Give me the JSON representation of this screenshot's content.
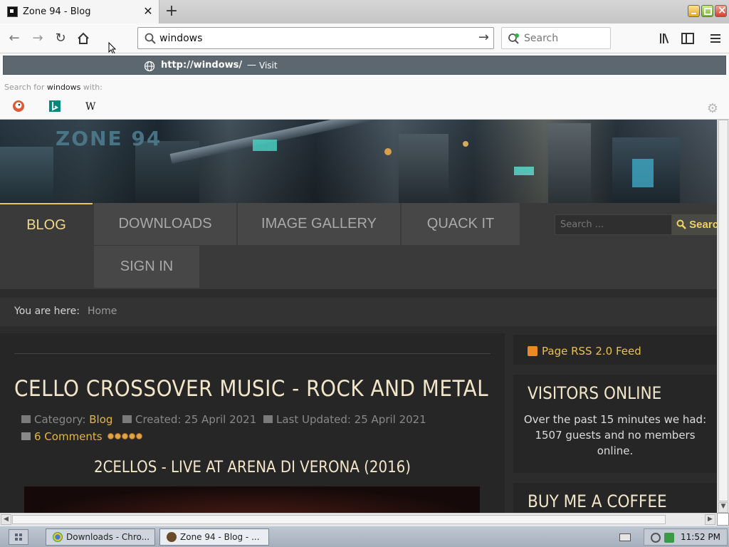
{
  "browser": {
    "tab": {
      "title": "Zone 94 - Blog"
    },
    "url_input": {
      "value": "windows "
    },
    "search_placeholder": "Search",
    "dropdown": {
      "url": "http://windows/",
      "dash": "—",
      "visit": "Visit",
      "search_for_prefix": "Search for",
      "search_for_term": "windows",
      "search_for_suffix": "with:"
    },
    "engines": [
      "duckduckgo-icon",
      "bing-icon",
      "wikipedia-icon"
    ]
  },
  "site": {
    "logo_text": "ZONE 94",
    "nav": [
      {
        "label": "BLOG",
        "active": true
      },
      {
        "label": "DOWNLOADS"
      },
      {
        "label": "IMAGE GALLERY"
      },
      {
        "label": "QUACK IT"
      },
      {
        "label": "SIGN IN"
      }
    ],
    "search_placeholder": "Search ...",
    "search_button": "Search",
    "breadcrumb": {
      "prefix": "You are here:",
      "home": "Home"
    },
    "article": {
      "title": "CELLO CROSSOVER MUSIC - ROCK AND METAL",
      "category_label": "Category:",
      "category": "Blog",
      "created": "Created: 25 April 2021",
      "updated": "Last Updated: 25 April 2021",
      "comments": "6 Comments",
      "rating_stars": 5,
      "subtitle": "2CELLOS - LIVE AT ARENA DI VERONA (2016)"
    },
    "sidebar": {
      "rss": "Page RSS 2.0 Feed",
      "visitors_title": "VISITORS ONLINE",
      "visitors_text": "Over the past 15 minutes we had: 1507 guests and no members online.",
      "coffee_title": "BUY ME A COFFEE"
    }
  },
  "taskbar": {
    "items": [
      "Downloads - Chro...",
      "Zone 94 - Blog - ..."
    ],
    "clock": "11:52 PM"
  },
  "colors": {
    "accent": "#e5b63f",
    "nav_active": "#f0d98a",
    "heading": "#f3e6c8",
    "dropdown_row": "#5c6770"
  }
}
